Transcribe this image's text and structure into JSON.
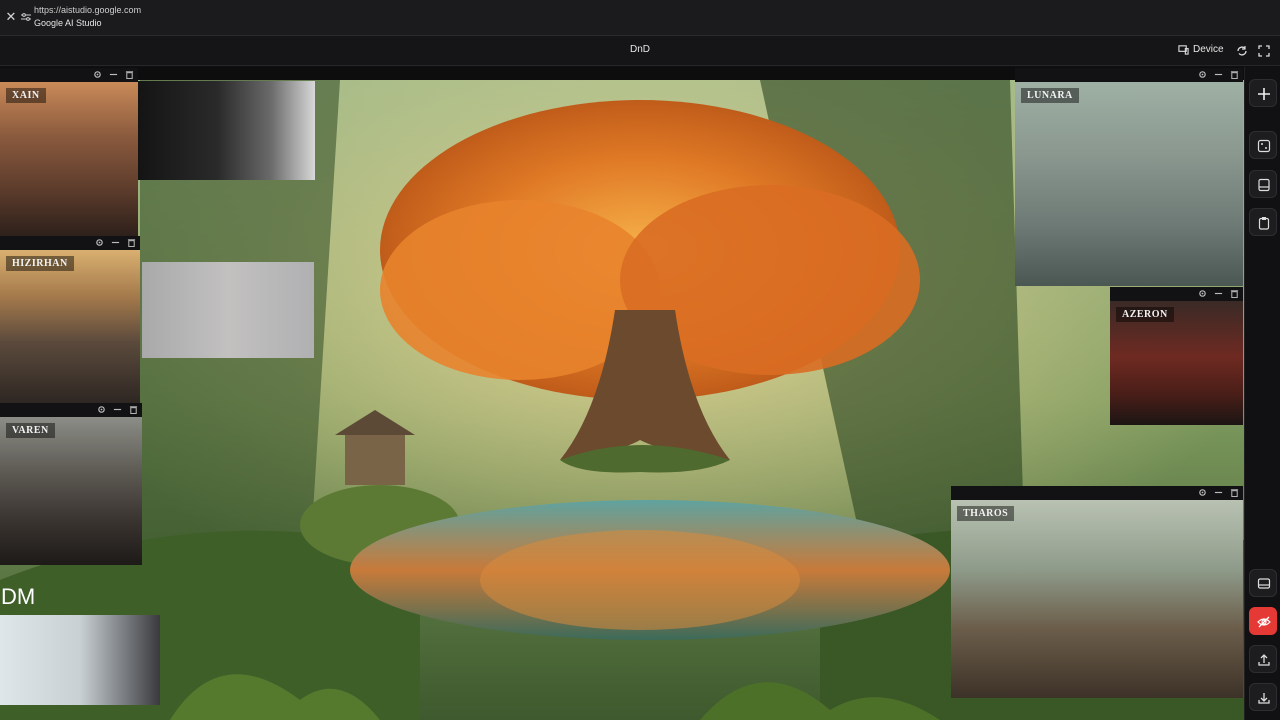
{
  "browser": {
    "url": "https://aistudio.google.com",
    "site": "Google AI Studio"
  },
  "app": {
    "title": "DnD",
    "device_label": "Device"
  },
  "characters": [
    {
      "name": "XAIN"
    },
    {
      "name": "HIZIRHAN"
    },
    {
      "name": "VAREN"
    },
    {
      "name": "LUNARA"
    },
    {
      "name": "AZERON"
    },
    {
      "name": "THAROS"
    }
  ],
  "dm_label": "DM",
  "colors": {
    "accent_red": "#e53935",
    "chrome_bg": "#1b1b1d",
    "stage_bg": "#0d0d0e"
  },
  "icons": [
    "close-icon",
    "tune-icon",
    "device-icon",
    "refresh-icon",
    "fullscreen-icon",
    "settings-icon",
    "minimize-icon",
    "trash-icon",
    "plus-icon",
    "frame-icon",
    "panel-icon",
    "clipboard-icon",
    "screen-icon",
    "eye-off-icon",
    "upload-icon",
    "download-icon"
  ]
}
